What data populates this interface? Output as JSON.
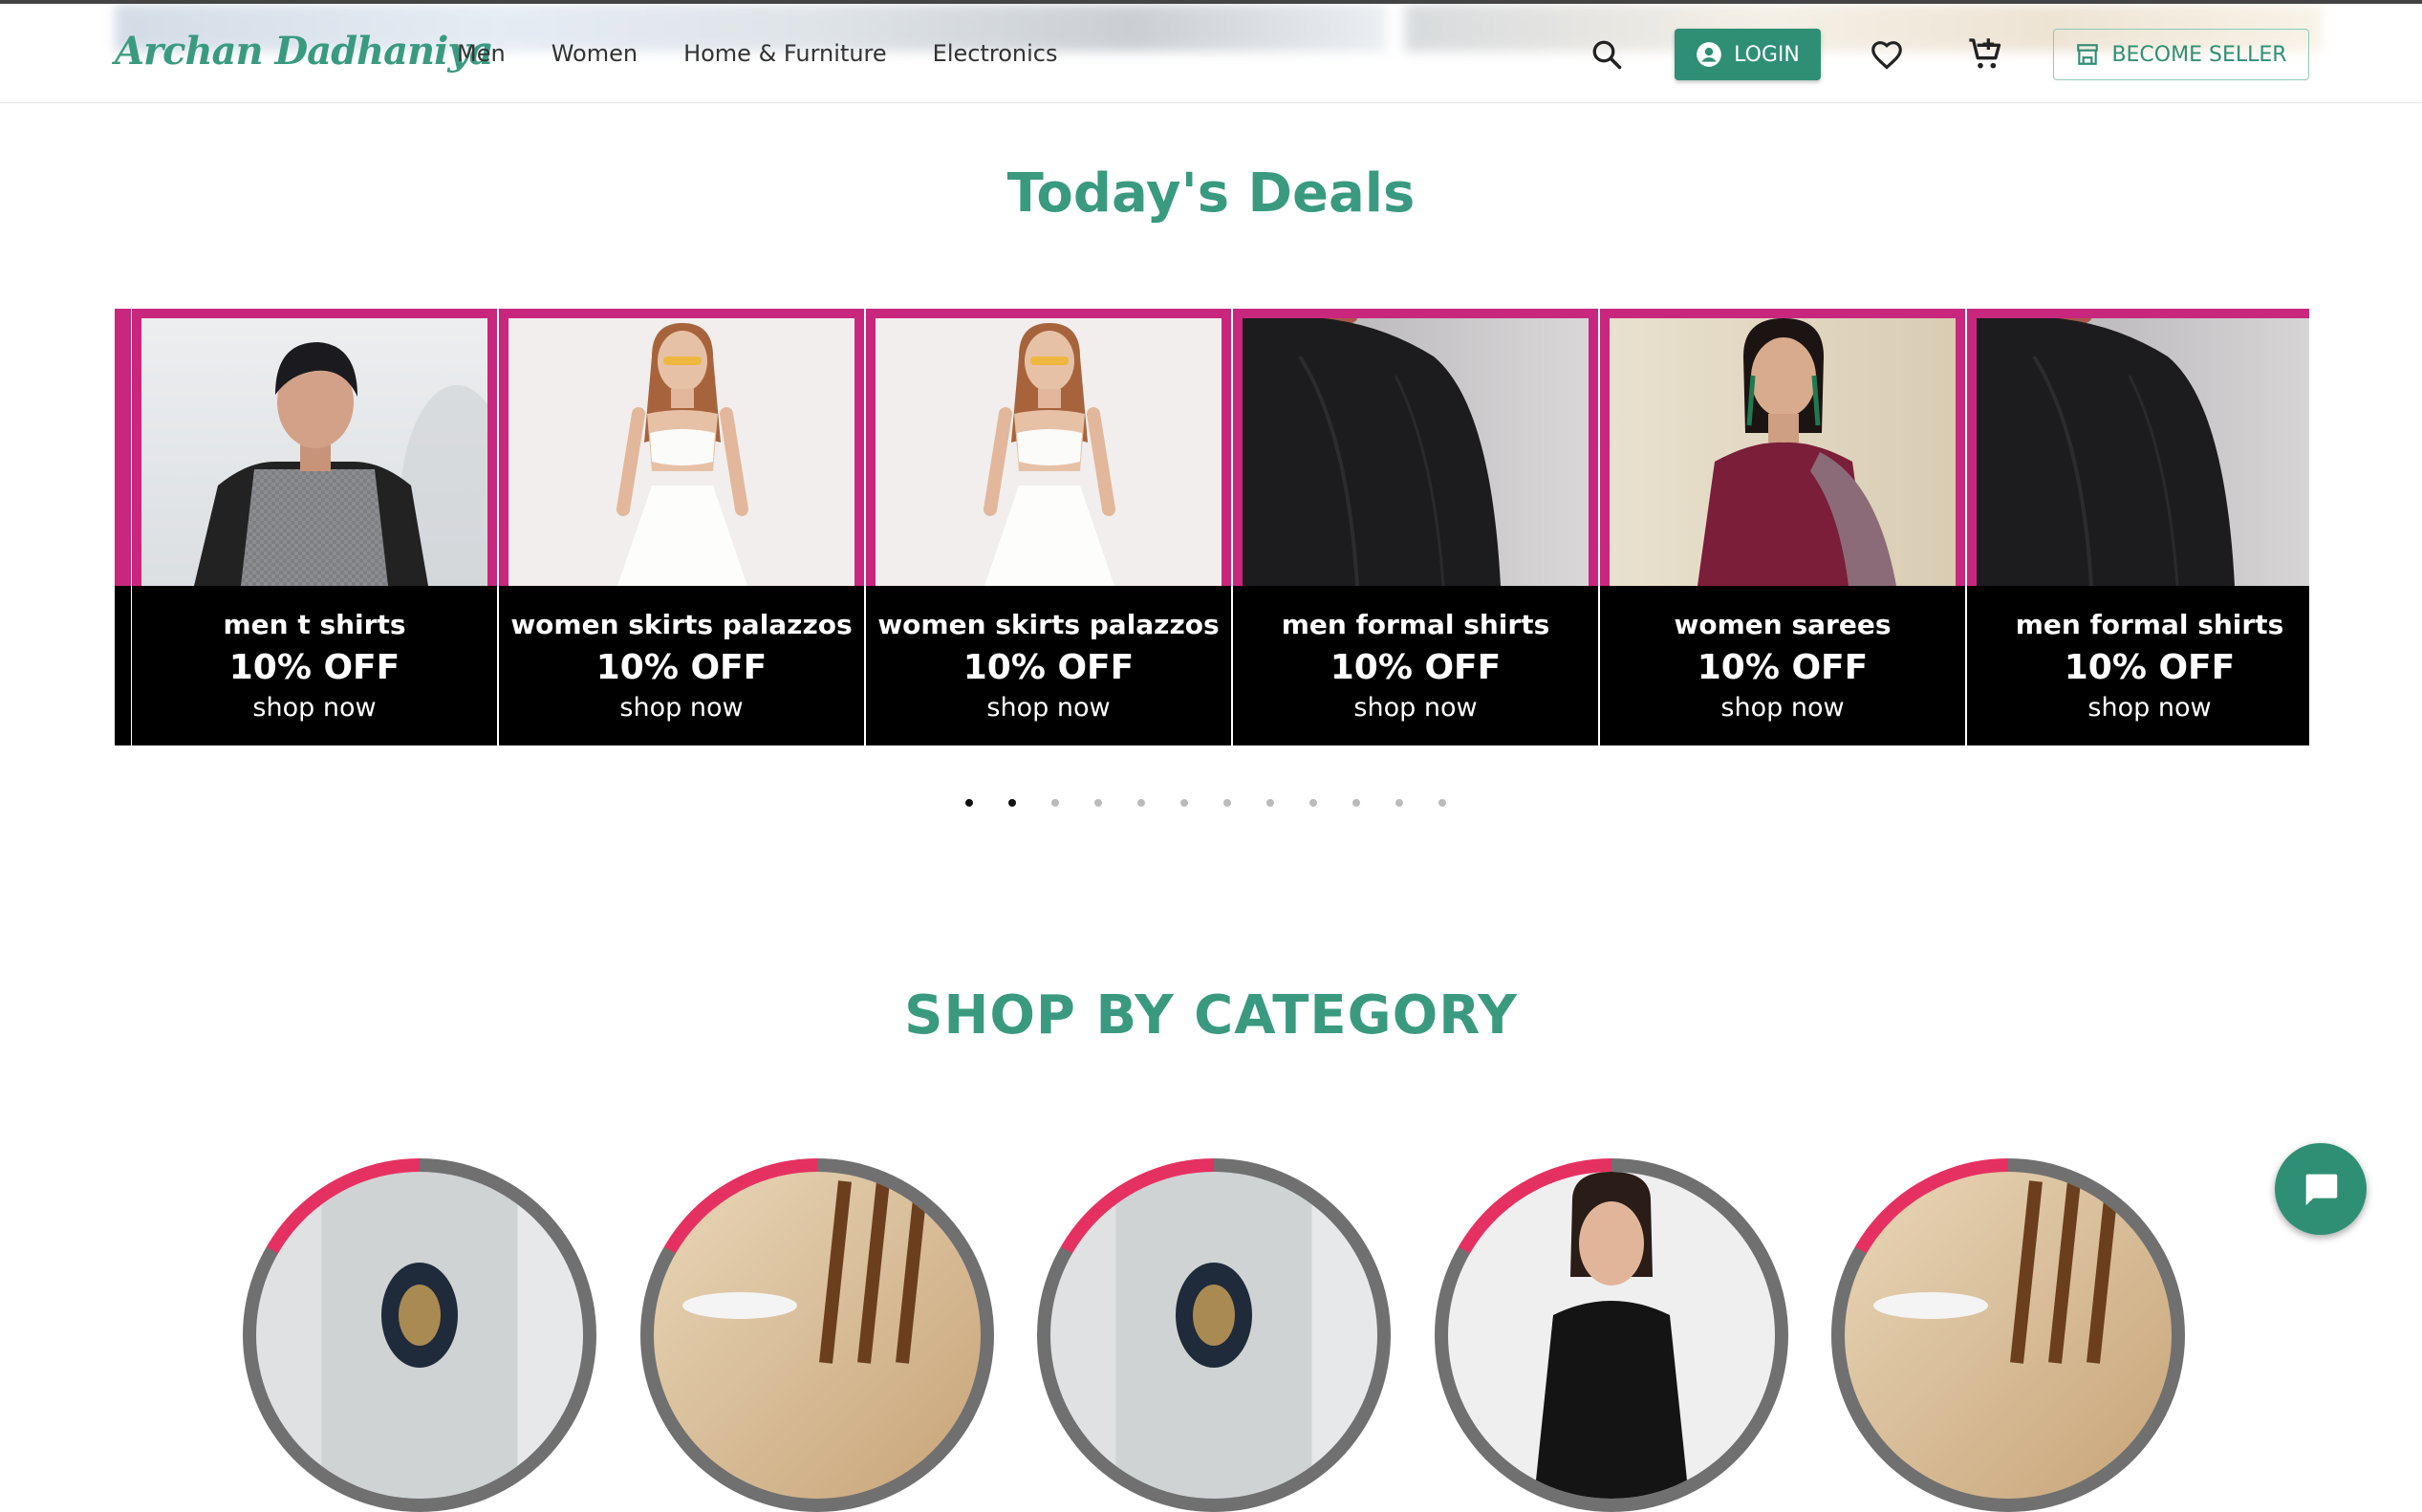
{
  "brand": {
    "logo_text": "Archan Dadhaniya"
  },
  "nav": {
    "links": [
      "Men",
      "Women",
      "Home & Furniture",
      "Electronics"
    ]
  },
  "header_actions": {
    "login_label": "LOGIN",
    "seller_label": "BECOME SELLER",
    "icons": [
      "search-icon",
      "account-circle-icon",
      "heart-icon",
      "cart-icon",
      "store-icon"
    ]
  },
  "deals": {
    "title": "Today's Deals",
    "cards": [
      {
        "name": "men t shirts",
        "discount": "10% OFF",
        "cta": "shop now",
        "photo": "man-raglan-tee"
      },
      {
        "name": "women skirts palazzos",
        "discount": "10% OFF",
        "cta": "shop now",
        "photo": "woman-white-skirt"
      },
      {
        "name": "women skirts palazzos",
        "discount": "10% OFF",
        "cta": "shop now",
        "photo": "woman-white-skirt"
      },
      {
        "name": "men formal shirts",
        "discount": "10% OFF",
        "cta": "shop now",
        "photo": "man-black-shirt"
      },
      {
        "name": "women sarees",
        "discount": "10% OFF",
        "cta": "shop now",
        "photo": "woman-saree"
      },
      {
        "name": "men formal shirts",
        "discount": "10% OFF",
        "cta": "shop now",
        "photo": "man-black-shirt"
      }
    ],
    "dots_total": 12,
    "dots_active": [
      0,
      1
    ]
  },
  "categories": {
    "title": "SHOP BY CATEGORY"
  },
  "colors": {
    "brand": "#3a9a80",
    "button": "#2f8f74",
    "card_border": "#c8277d",
    "ring_accent": "#e53162"
  }
}
